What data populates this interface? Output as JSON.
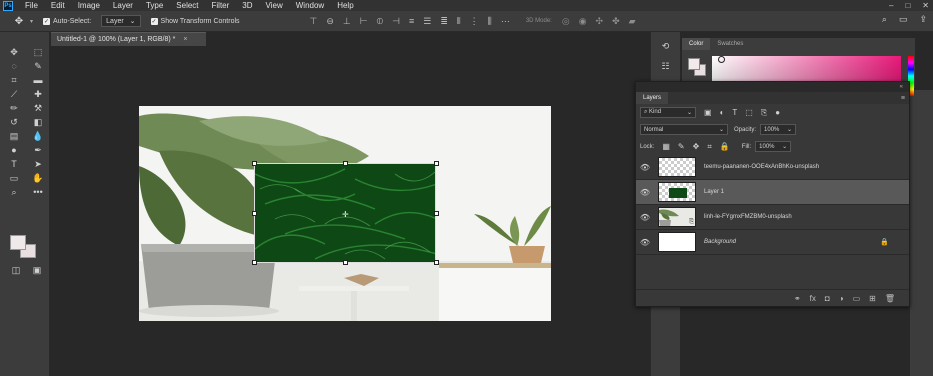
{
  "menubar": {
    "logo": "Ps",
    "items": [
      "File",
      "Edit",
      "Image",
      "Layer",
      "Type",
      "Select",
      "Filter",
      "3D",
      "View",
      "Window",
      "Help"
    ],
    "window_controls": [
      "–",
      "□",
      "✕"
    ]
  },
  "options": {
    "tool_icon": "move-icon",
    "auto_select_label": "Auto-Select:",
    "auto_select_checked": true,
    "auto_select_target": "Layer",
    "transform_label": "Show Transform Controls",
    "transform_checked": true,
    "mode_3d_label": "3D Mode:"
  },
  "document": {
    "tab_title": "Untitled-1 @ 100% (Layer 1, RGB/8) *",
    "close_glyph": "×"
  },
  "color_panel": {
    "tabs": [
      "Color",
      "Swatches"
    ],
    "active_tab": "Color",
    "hue_color": "#e8197a"
  },
  "layers_panel": {
    "tab": "Layers",
    "filter_kind": "Kind",
    "blend_mode": "Normal",
    "opacity_label": "Opacity:",
    "opacity_value": "100%",
    "lock_label": "Lock:",
    "fill_label": "Fill:",
    "fill_value": "100%",
    "layers": [
      {
        "name": "teemu-paananen-OOE4xAnBhKo-unsplash",
        "thumb": "transparent",
        "selected": false,
        "italic": false,
        "locked": false
      },
      {
        "name": "Layer 1",
        "thumb": "green",
        "selected": true,
        "italic": false,
        "locked": false
      },
      {
        "name": "linh-le-FYgmxFMZBM0-unsplash",
        "thumb": "photo",
        "selected": false,
        "italic": false,
        "locked": false
      },
      {
        "name": "Background",
        "thumb": "white",
        "selected": false,
        "italic": true,
        "locked": true
      }
    ]
  },
  "colors": {
    "accent": "#31a8ff",
    "layer_fill": "#0f4a16"
  }
}
